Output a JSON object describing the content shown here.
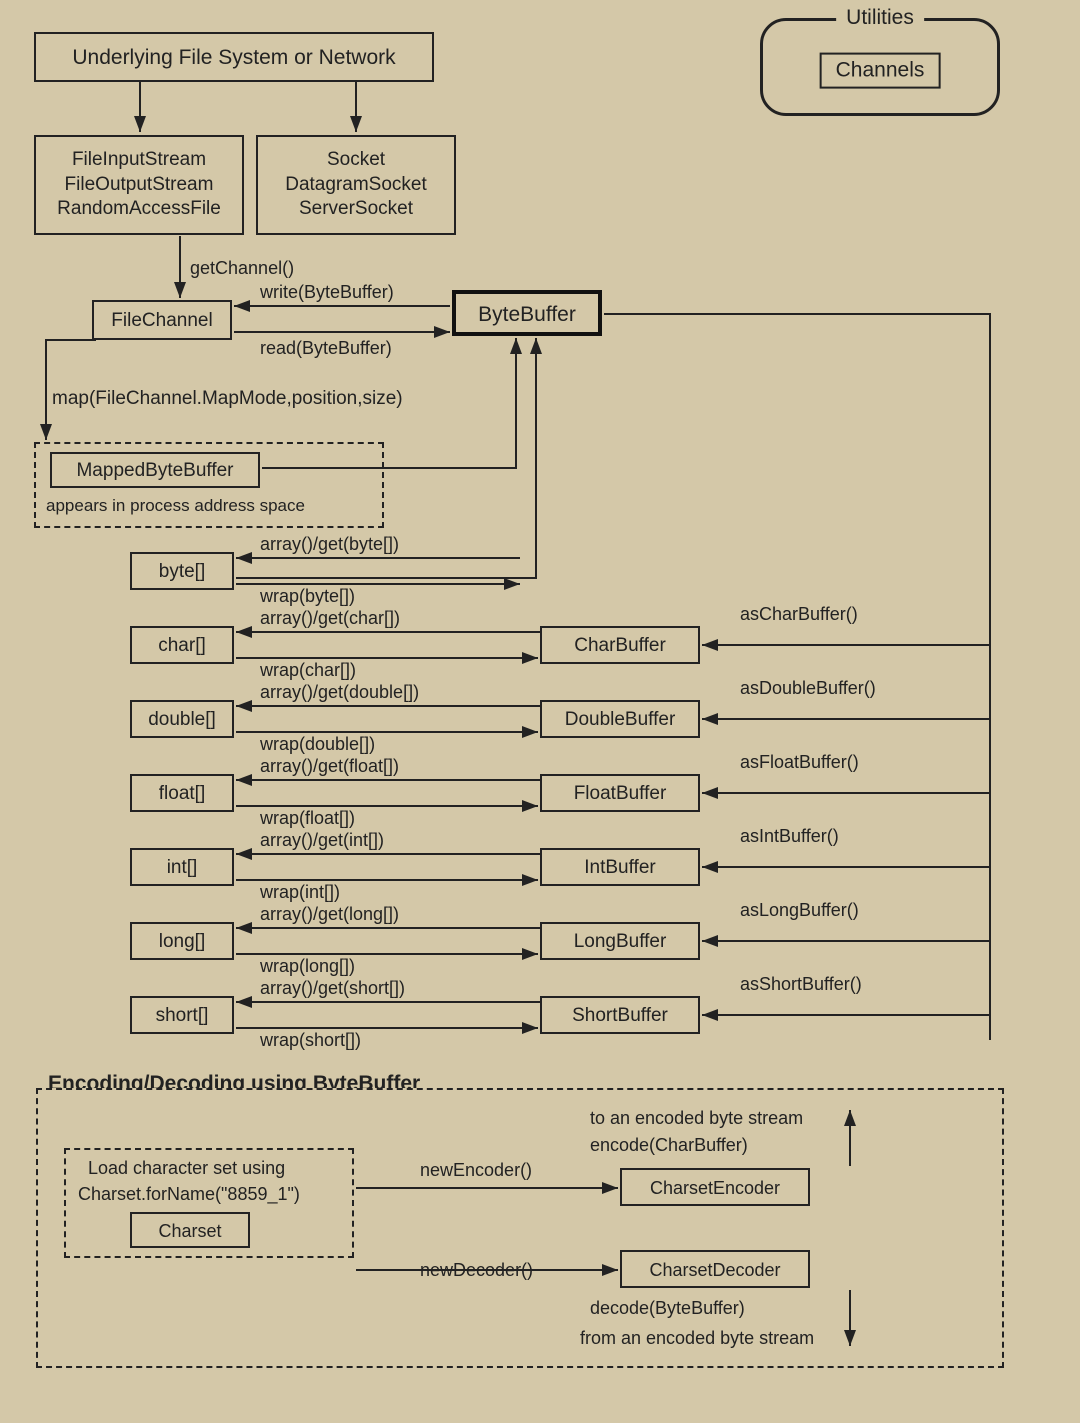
{
  "top_box": "Underlying File System or Network",
  "utilities": {
    "legend": "Utilities",
    "inner": "Channels"
  },
  "file_box": {
    "l1": "FileInputStream",
    "l2": "FileOutputStream",
    "l3": "RandomAccessFile"
  },
  "socket_box": {
    "l1": "Socket",
    "l2": "DatagramSocket",
    "l3": "ServerSocket"
  },
  "getChannel": "getChannel()",
  "fileChannel": "FileChannel",
  "writeBB": "write(ByteBuffer)",
  "readBB": "read(ByteBuffer)",
  "byteBuffer": "ByteBuffer",
  "mapCall": "map(FileChannel.MapMode,position,size)",
  "mapped": {
    "title": "MappedByteBuffer",
    "note": "appears in process address space"
  },
  "rows": [
    {
      "arr": "byte[]",
      "top": "array()/get(byte[])",
      "bot": "wrap(byte[])",
      "buf": null,
      "as": null
    },
    {
      "arr": "char[]",
      "top": "array()/get(char[])",
      "bot": "wrap(char[])",
      "buf": "CharBuffer",
      "as": "asCharBuffer()"
    },
    {
      "arr": "double[]",
      "top": "array()/get(double[])",
      "bot": "wrap(double[])",
      "buf": "DoubleBuffer",
      "as": "asDoubleBuffer()"
    },
    {
      "arr": "float[]",
      "top": "array()/get(float[])",
      "bot": "wrap(float[])",
      "buf": "FloatBuffer",
      "as": "asFloatBuffer()"
    },
    {
      "arr": "int[]",
      "top": "array()/get(int[])",
      "bot": "wrap(int[])",
      "buf": "IntBuffer",
      "as": "asIntBuffer()"
    },
    {
      "arr": "long[]",
      "top": "array()/get(long[])",
      "bot": "wrap(long[])",
      "buf": "LongBuffer",
      "as": "asLongBuffer()"
    },
    {
      "arr": "short[]",
      "top": "array()/get(short[])",
      "bot": "wrap(short[])",
      "buf": "ShortBuffer",
      "as": "asShortBuffer()"
    }
  ],
  "enc_section": "Encoding/Decoding using ByteBuffer",
  "charset_note": {
    "l1": "Load character set using",
    "l2": "Charset.forName(\"8859_1\")"
  },
  "charset": "Charset",
  "newEncoder": "newEncoder()",
  "newDecoder": "newDecoder()",
  "charsetEncoder": "CharsetEncoder",
  "charsetDecoder": "CharsetDecoder",
  "to_stream": "to an encoded byte stream",
  "encode": "encode(CharBuffer)",
  "decode": "decode(ByteBuffer)",
  "from_stream": "from an encoded byte stream"
}
